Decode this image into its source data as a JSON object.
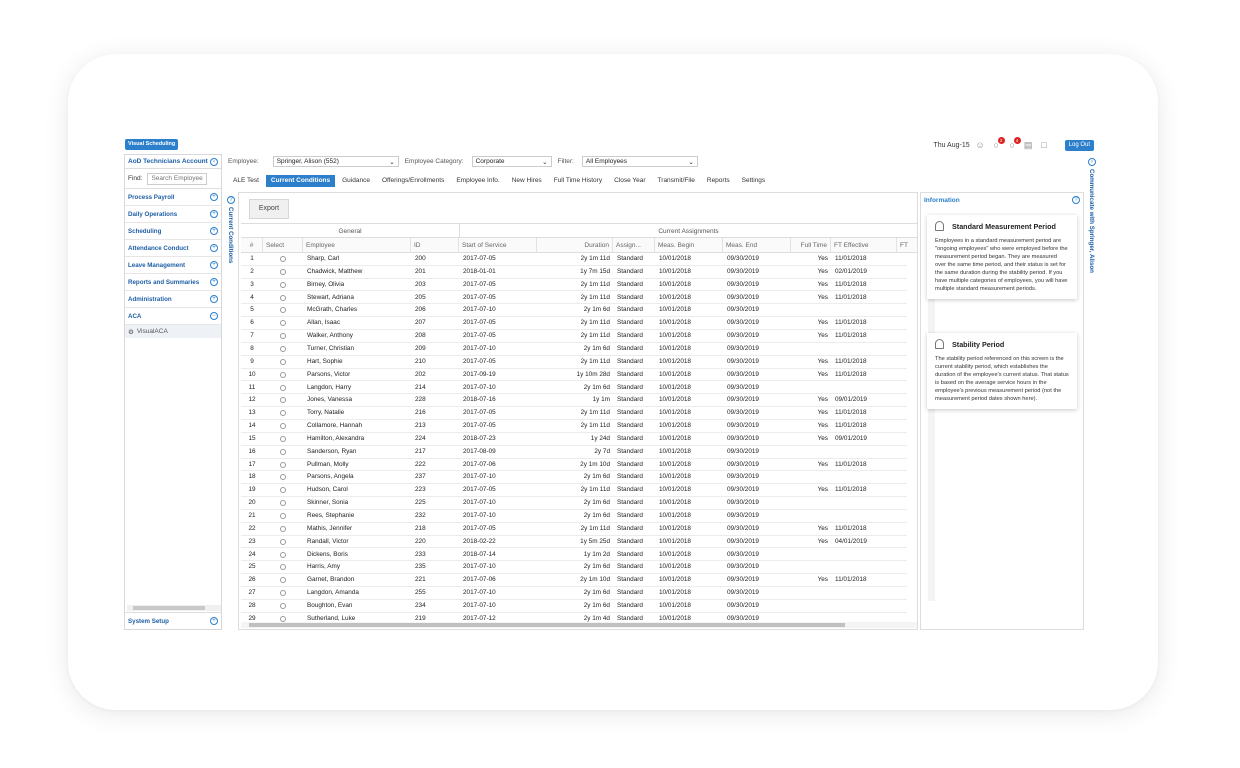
{
  "topbar": {
    "visual_scheduling": "Visual Scheduling",
    "date": "Thu Aug-15",
    "notif_count_1": "2",
    "notif_count_2": "4",
    "logout": "Log Out"
  },
  "sidebar": {
    "account": "AoD Technicians Account",
    "find_label": "Find:",
    "find_placeholder": "Search Employee",
    "items": [
      "Process Payroll",
      "Daily Operations",
      "Scheduling",
      "Attendance Conduct",
      "Leave Management",
      "Reports and Summaries",
      "Administration",
      "ACA"
    ],
    "sub_item": "VisualACA",
    "system_setup": "System Setup"
  },
  "side_tab": "Current Conditions",
  "filters": {
    "employee_label": "Employee:",
    "employee_value": "Springer, Alison  (552)",
    "category_label": "Employee Category:",
    "category_value": "Corporate",
    "filter_label": "Filter:",
    "filter_value": "All Employees"
  },
  "tabs": [
    "ALE Test",
    "Current Conditions",
    "Guidance",
    "Offerings/Enrollments",
    "Employee Info.",
    "New Hires",
    "Full Time History",
    "Close Year",
    "Transmit/File",
    "Reports",
    "Settings"
  ],
  "export": "Export",
  "grid": {
    "group_general": "General",
    "group_current": "Current Assignments",
    "columns": [
      "#",
      "Select",
      "Employee",
      "ID",
      "Start of Service",
      "Duration",
      "Assign...",
      "Meas. Begin",
      "Meas. End",
      "Full Time",
      "FT Effective",
      "FT"
    ],
    "rows": [
      [
        "1",
        "Sharp, Carl",
        "200",
        "2017-07-05",
        "2y 1m 11d",
        "Standard",
        "10/01/2018",
        "09/30/2019",
        "Yes",
        "11/01/2018"
      ],
      [
        "2",
        "Chadwick, Matthew",
        "201",
        "2018-01-01",
        "1y 7m 15d",
        "Standard",
        "10/01/2018",
        "09/30/2019",
        "Yes",
        "02/01/2019"
      ],
      [
        "3",
        "Birney, Olivia",
        "203",
        "2017-07-05",
        "2y 1m 11d",
        "Standard",
        "10/01/2018",
        "09/30/2019",
        "Yes",
        "11/01/2018"
      ],
      [
        "4",
        "Stewart, Adriana",
        "205",
        "2017-07-05",
        "2y 1m 11d",
        "Standard",
        "10/01/2018",
        "09/30/2019",
        "Yes",
        "11/01/2018"
      ],
      [
        "5",
        "McGrath, Charles",
        "206",
        "2017-07-10",
        "2y 1m 6d",
        "Standard",
        "10/01/2018",
        "09/30/2019",
        "",
        ""
      ],
      [
        "6",
        "Allan, Isaac",
        "207",
        "2017-07-05",
        "2y 1m 11d",
        "Standard",
        "10/01/2018",
        "09/30/2019",
        "Yes",
        "11/01/2018"
      ],
      [
        "7",
        "Walker, Anthony",
        "208",
        "2017-07-05",
        "2y 1m 11d",
        "Standard",
        "10/01/2018",
        "09/30/2019",
        "Yes",
        "11/01/2018"
      ],
      [
        "8",
        "Turner, Christian",
        "209",
        "2017-07-10",
        "2y 1m 6d",
        "Standard",
        "10/01/2018",
        "09/30/2019",
        "",
        ""
      ],
      [
        "9",
        "Hart, Sophie",
        "210",
        "2017-07-05",
        "2y 1m 11d",
        "Standard",
        "10/01/2018",
        "09/30/2019",
        "Yes",
        "11/01/2018"
      ],
      [
        "10",
        "Parsons, Victor",
        "202",
        "2017-09-19",
        "1y 10m 28d",
        "Standard",
        "10/01/2018",
        "09/30/2019",
        "Yes",
        "11/01/2018"
      ],
      [
        "11",
        "Langdon, Harry",
        "214",
        "2017-07-10",
        "2y 1m 6d",
        "Standard",
        "10/01/2018",
        "09/30/2019",
        "",
        ""
      ],
      [
        "12",
        "Jones, Vanessa",
        "228",
        "2018-07-16",
        "1y 1m",
        "Standard",
        "10/01/2018",
        "09/30/2019",
        "Yes",
        "09/01/2019"
      ],
      [
        "13",
        "Torry, Natalie",
        "216",
        "2017-07-05",
        "2y 1m 11d",
        "Standard",
        "10/01/2018",
        "09/30/2019",
        "Yes",
        "11/01/2018"
      ],
      [
        "14",
        "Collamore, Hannah",
        "213",
        "2017-07-05",
        "2y 1m 11d",
        "Standard",
        "10/01/2018",
        "09/30/2019",
        "Yes",
        "11/01/2018"
      ],
      [
        "15",
        "Hamilton, Alexandra",
        "224",
        "2018-07-23",
        "1y 24d",
        "Standard",
        "10/01/2018",
        "09/30/2019",
        "Yes",
        "09/01/2019"
      ],
      [
        "16",
        "Sanderson, Ryan",
        "217",
        "2017-08-09",
        "2y 7d",
        "Standard",
        "10/01/2018",
        "09/30/2019",
        "",
        ""
      ],
      [
        "17",
        "Pullman, Molly",
        "222",
        "2017-07-06",
        "2y 1m 10d",
        "Standard",
        "10/01/2018",
        "09/30/2019",
        "Yes",
        "11/01/2018"
      ],
      [
        "18",
        "Parsons, Angela",
        "237",
        "2017-07-10",
        "2y 1m 6d",
        "Standard",
        "10/01/2018",
        "09/30/2019",
        "",
        ""
      ],
      [
        "19",
        "Hudson, Carol",
        "223",
        "2017-07-05",
        "2y 1m 11d",
        "Standard",
        "10/01/2018",
        "09/30/2019",
        "Yes",
        "11/01/2018"
      ],
      [
        "20",
        "Skinner, Sonia",
        "225",
        "2017-07-10",
        "2y 1m 6d",
        "Standard",
        "10/01/2018",
        "09/30/2019",
        "",
        ""
      ],
      [
        "21",
        "Rees, Stephanie",
        "232",
        "2017-07-10",
        "2y 1m 6d",
        "Standard",
        "10/01/2018",
        "09/30/2019",
        "",
        ""
      ],
      [
        "22",
        "Mathis, Jennifer",
        "218",
        "2017-07-05",
        "2y 1m 11d",
        "Standard",
        "10/01/2018",
        "09/30/2019",
        "Yes",
        "11/01/2018"
      ],
      [
        "23",
        "Randall, Victor",
        "220",
        "2018-02-22",
        "1y 5m 25d",
        "Standard",
        "10/01/2018",
        "09/30/2019",
        "Yes",
        "04/01/2019"
      ],
      [
        "24",
        "Dickens, Boris",
        "233",
        "2018-07-14",
        "1y 1m 2d",
        "Standard",
        "10/01/2018",
        "09/30/2019",
        "",
        ""
      ],
      [
        "25",
        "Harris, Amy",
        "235",
        "2017-07-10",
        "2y 1m 6d",
        "Standard",
        "10/01/2018",
        "09/30/2019",
        "",
        ""
      ],
      [
        "26",
        "Garnet, Brandon",
        "221",
        "2017-07-06",
        "2y 1m 10d",
        "Standard",
        "10/01/2018",
        "09/30/2019",
        "Yes",
        "11/01/2018"
      ],
      [
        "27",
        "Langdon, Amanda",
        "255",
        "2017-07-10",
        "2y 1m 6d",
        "Standard",
        "10/01/2018",
        "09/30/2019",
        "",
        ""
      ],
      [
        "28",
        "Boughton, Evan",
        "234",
        "2017-07-10",
        "2y 1m 6d",
        "Standard",
        "10/01/2018",
        "09/30/2019",
        "",
        ""
      ],
      [
        "29",
        "Sutherland, Luke",
        "219",
        "2017-07-12",
        "2y 1m 4d",
        "Standard",
        "10/01/2018",
        "09/30/2019",
        "",
        ""
      ]
    ]
  },
  "info": {
    "header": "Information",
    "card1_title": "Standard Measurement Period",
    "card1_body": "Employees in a standard measurement period are \"ongoing employees\" who were employed before the measurement period began. They are measured over the same time period, and their status is set for the same duration during the stability period. If you have multiple categories of employees, you will have multiple standard measurement periods.",
    "card2_title": "Stability Period",
    "card2_body": "The stability period referenced on this screen is the current stability period, which establishes the duration of the employee's current status. That status is based on the average service hours in the employee's previous measurement period (not the measurement period dates shown here)."
  },
  "right_tab": "Communicate with Springer, Alison",
  "colors": {
    "accent": "#2b7fcb",
    "nav_text": "#1f5fa6",
    "badge": "#e02020"
  }
}
